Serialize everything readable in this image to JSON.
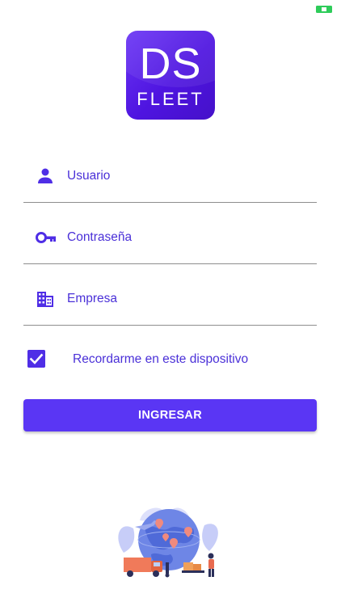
{
  "app": {
    "logo_title": "DS",
    "logo_subtitle": "FLEET"
  },
  "form": {
    "username_label": "Usuario",
    "password_label": "Contraseña",
    "company_label": "Empresa",
    "remember_label": "Recordarme en este dispositivo",
    "remember_checked": true,
    "submit_label": "INGRESAR"
  },
  "icons": {
    "status": "battery-indicator-icon",
    "username": "person-icon",
    "password": "key-icon",
    "company": "building-icon",
    "remember": "checkbox-checked-icon",
    "illustration": "logistics-globe-illustration"
  },
  "colors": {
    "brand": "#5a36f4",
    "logo_bg": "#5520e8",
    "text_accent": "#4a30d8",
    "divider": "#8e8e8e",
    "status_indicator": "#2ecc5a"
  }
}
